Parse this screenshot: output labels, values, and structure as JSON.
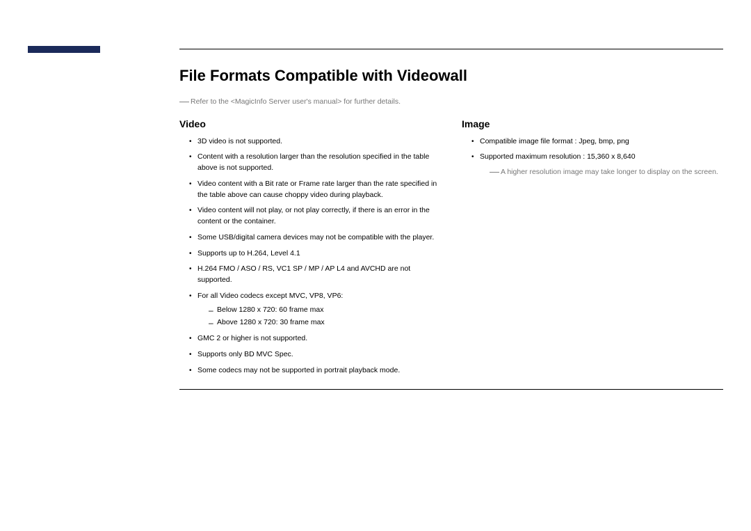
{
  "heading": "File Formats Compatible with Videowall",
  "note": "Refer to the <MagicInfo Server user's manual> for further details.",
  "video": {
    "title": "Video",
    "items": [
      "3D video is not supported.",
      "Content with a resolution larger than the resolution specified in the table above is not supported.",
      "Video content with a Bit rate or Frame rate larger than the rate specified in the table above can cause choppy video during playback.",
      "Video content will not play, or not play correctly, if there is an error in the content or the container.",
      "Some USB/digital camera devices may not be compatible with the player.",
      "Supports up to H.264, Level 4.1",
      "H.264 FMO / ASO / RS, VC1 SP / MP / AP L4 and AVCHD are not supported.",
      "For all Video codecs except MVC, VP8, VP6:",
      "GMC 2 or higher is not supported.",
      "Supports only BD MVC Spec.",
      "Some codecs may not be supported in portrait playback mode."
    ],
    "sub": [
      "Below 1280 x 720: 60 frame max",
      "Above 1280 x 720: 30 frame max"
    ]
  },
  "image": {
    "title": "Image",
    "items": [
      "Compatible image file format : Jpeg, bmp, png",
      "Supported maximum resolution : 15,360 x 8,640"
    ],
    "subnote": "A higher resolution image may take longer to display on the screen."
  }
}
